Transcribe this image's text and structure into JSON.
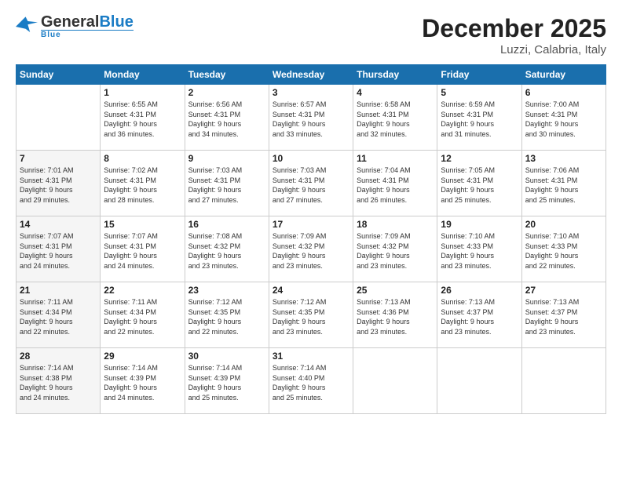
{
  "header": {
    "logo": {
      "name_part1": "General",
      "name_part2": "Blue",
      "subtext": "Blue"
    },
    "title": "December 2025",
    "location": "Luzzi, Calabria, Italy"
  },
  "calendar": {
    "days_of_week": [
      "Sunday",
      "Monday",
      "Tuesday",
      "Wednesday",
      "Thursday",
      "Friday",
      "Saturday"
    ],
    "weeks": [
      [
        {
          "day": "",
          "info": ""
        },
        {
          "day": "1",
          "info": "Sunrise: 6:55 AM\nSunset: 4:31 PM\nDaylight: 9 hours\nand 36 minutes."
        },
        {
          "day": "2",
          "info": "Sunrise: 6:56 AM\nSunset: 4:31 PM\nDaylight: 9 hours\nand 34 minutes."
        },
        {
          "day": "3",
          "info": "Sunrise: 6:57 AM\nSunset: 4:31 PM\nDaylight: 9 hours\nand 33 minutes."
        },
        {
          "day": "4",
          "info": "Sunrise: 6:58 AM\nSunset: 4:31 PM\nDaylight: 9 hours\nand 32 minutes."
        },
        {
          "day": "5",
          "info": "Sunrise: 6:59 AM\nSunset: 4:31 PM\nDaylight: 9 hours\nand 31 minutes."
        },
        {
          "day": "6",
          "info": "Sunrise: 7:00 AM\nSunset: 4:31 PM\nDaylight: 9 hours\nand 30 minutes."
        }
      ],
      [
        {
          "day": "7",
          "info": "Sunrise: 7:01 AM\nSunset: 4:31 PM\nDaylight: 9 hours\nand 29 minutes."
        },
        {
          "day": "8",
          "info": "Sunrise: 7:02 AM\nSunset: 4:31 PM\nDaylight: 9 hours\nand 28 minutes."
        },
        {
          "day": "9",
          "info": "Sunrise: 7:03 AM\nSunset: 4:31 PM\nDaylight: 9 hours\nand 27 minutes."
        },
        {
          "day": "10",
          "info": "Sunrise: 7:03 AM\nSunset: 4:31 PM\nDaylight: 9 hours\nand 27 minutes."
        },
        {
          "day": "11",
          "info": "Sunrise: 7:04 AM\nSunset: 4:31 PM\nDaylight: 9 hours\nand 26 minutes."
        },
        {
          "day": "12",
          "info": "Sunrise: 7:05 AM\nSunset: 4:31 PM\nDaylight: 9 hours\nand 25 minutes."
        },
        {
          "day": "13",
          "info": "Sunrise: 7:06 AM\nSunset: 4:31 PM\nDaylight: 9 hours\nand 25 minutes."
        }
      ],
      [
        {
          "day": "14",
          "info": "Sunrise: 7:07 AM\nSunset: 4:31 PM\nDaylight: 9 hours\nand 24 minutes."
        },
        {
          "day": "15",
          "info": "Sunrise: 7:07 AM\nSunset: 4:31 PM\nDaylight: 9 hours\nand 24 minutes."
        },
        {
          "day": "16",
          "info": "Sunrise: 7:08 AM\nSunset: 4:32 PM\nDaylight: 9 hours\nand 23 minutes."
        },
        {
          "day": "17",
          "info": "Sunrise: 7:09 AM\nSunset: 4:32 PM\nDaylight: 9 hours\nand 23 minutes."
        },
        {
          "day": "18",
          "info": "Sunrise: 7:09 AM\nSunset: 4:32 PM\nDaylight: 9 hours\nand 23 minutes."
        },
        {
          "day": "19",
          "info": "Sunrise: 7:10 AM\nSunset: 4:33 PM\nDaylight: 9 hours\nand 23 minutes."
        },
        {
          "day": "20",
          "info": "Sunrise: 7:10 AM\nSunset: 4:33 PM\nDaylight: 9 hours\nand 22 minutes."
        }
      ],
      [
        {
          "day": "21",
          "info": "Sunrise: 7:11 AM\nSunset: 4:34 PM\nDaylight: 9 hours\nand 22 minutes."
        },
        {
          "day": "22",
          "info": "Sunrise: 7:11 AM\nSunset: 4:34 PM\nDaylight: 9 hours\nand 22 minutes."
        },
        {
          "day": "23",
          "info": "Sunrise: 7:12 AM\nSunset: 4:35 PM\nDaylight: 9 hours\nand 22 minutes."
        },
        {
          "day": "24",
          "info": "Sunrise: 7:12 AM\nSunset: 4:35 PM\nDaylight: 9 hours\nand 23 minutes."
        },
        {
          "day": "25",
          "info": "Sunrise: 7:13 AM\nSunset: 4:36 PM\nDaylight: 9 hours\nand 23 minutes."
        },
        {
          "day": "26",
          "info": "Sunrise: 7:13 AM\nSunset: 4:37 PM\nDaylight: 9 hours\nand 23 minutes."
        },
        {
          "day": "27",
          "info": "Sunrise: 7:13 AM\nSunset: 4:37 PM\nDaylight: 9 hours\nand 23 minutes."
        }
      ],
      [
        {
          "day": "28",
          "info": "Sunrise: 7:14 AM\nSunset: 4:38 PM\nDaylight: 9 hours\nand 24 minutes."
        },
        {
          "day": "29",
          "info": "Sunrise: 7:14 AM\nSunset: 4:39 PM\nDaylight: 9 hours\nand 24 minutes."
        },
        {
          "day": "30",
          "info": "Sunrise: 7:14 AM\nSunset: 4:39 PM\nDaylight: 9 hours\nand 25 minutes."
        },
        {
          "day": "31",
          "info": "Sunrise: 7:14 AM\nSunset: 4:40 PM\nDaylight: 9 hours\nand 25 minutes."
        },
        {
          "day": "",
          "info": ""
        },
        {
          "day": "",
          "info": ""
        },
        {
          "day": "",
          "info": ""
        }
      ]
    ]
  }
}
